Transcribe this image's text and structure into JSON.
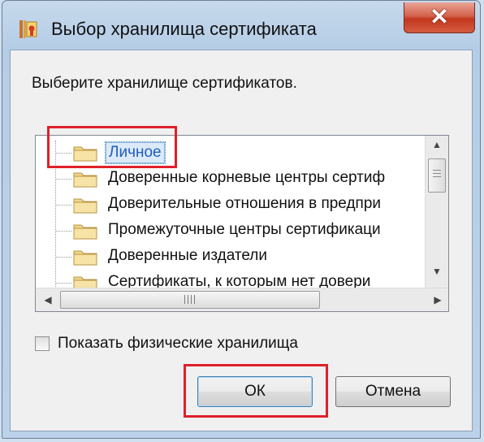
{
  "window": {
    "title": "Выбор хранилища сертификата",
    "close_label": "✕"
  },
  "prompt": "Выберите хранилище сертификатов.",
  "tree": {
    "items": [
      {
        "label": "Личное",
        "selected": true
      },
      {
        "label": "Доверенные корневые центры сертиф"
      },
      {
        "label": "Доверительные отношения в предпри"
      },
      {
        "label": "Промежуточные центры сертификаци"
      },
      {
        "label": "Доверенные издатели"
      },
      {
        "label": "Сертификаты, к которым нет довери"
      }
    ],
    "hscroll_grip": "III"
  },
  "checkbox": {
    "label": "Показать физические хранилища",
    "checked": false
  },
  "buttons": {
    "ok": "ОК",
    "cancel": "Отмена"
  },
  "colors": {
    "highlight": "#e0202a",
    "selection": "#1f5dbe",
    "close_button": "#c2381f"
  },
  "icons": {
    "app": "certificate-app-icon",
    "folder": "folder-icon",
    "close": "close-icon"
  }
}
